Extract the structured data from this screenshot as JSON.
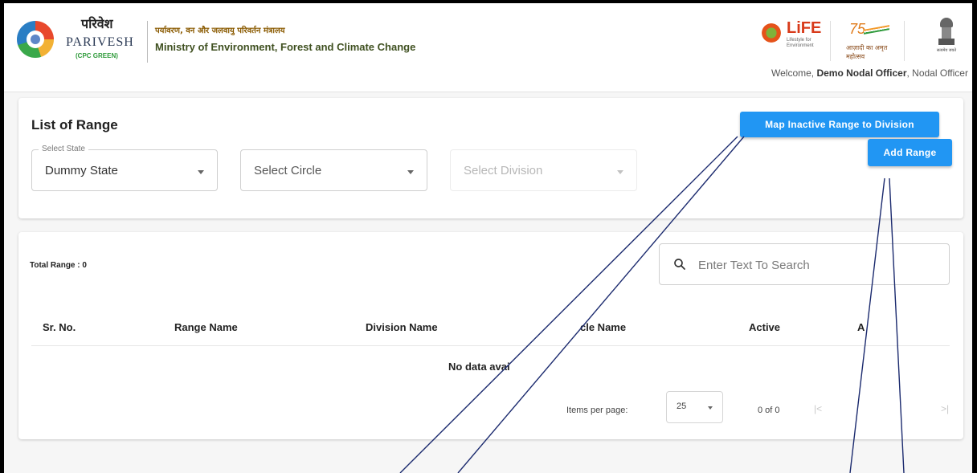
{
  "header": {
    "brand_hindi": "परिवेश",
    "brand_name": "PARIVESH",
    "brand_sub": "(CPC GREEN)",
    "ministry_hindi": "पर्यावरण, वन और जलवायु परिवर्तन मंत्रालय",
    "ministry_english": "Ministry of Environment, Forest and Climate Change",
    "life_logo": "LiFE",
    "life_tagline": "Lifestyle for Environment",
    "azadi_number": "75",
    "azadi_text": "आज़ादी का अमृत महोत्सव",
    "emblem_caption": "सत्यमेव जयते",
    "welcome_prefix": "Welcome, ",
    "user_name": "Demo Nodal Officer",
    "user_role": ", Nodal Officer"
  },
  "range_panel": {
    "title": "List of Range",
    "map_button": "Map Inactive Range to Division",
    "add_button": "Add Range",
    "state_select": {
      "legend": "Select State",
      "value": "Dummy State"
    },
    "circle_select": {
      "placeholder": "Select Circle"
    },
    "division_select": {
      "placeholder": "Select Division"
    }
  },
  "table_panel": {
    "total_label": "Total Range : 0",
    "search_placeholder": "Enter Text To Search",
    "columns": [
      "Sr. No.",
      "Range Name",
      "Division Name",
      "cle Name",
      "Active",
      "A"
    ],
    "empty_message": "No data avai",
    "items_per_page_label": "Items per page:",
    "items_per_page": "25",
    "range_label": "0 of 0",
    "first_page_icon": "first-page-icon",
    "last_page_icon": "last-page-icon"
  },
  "colors": {
    "primary_button": "#2196f3",
    "page_background": "#f6f6f6"
  }
}
